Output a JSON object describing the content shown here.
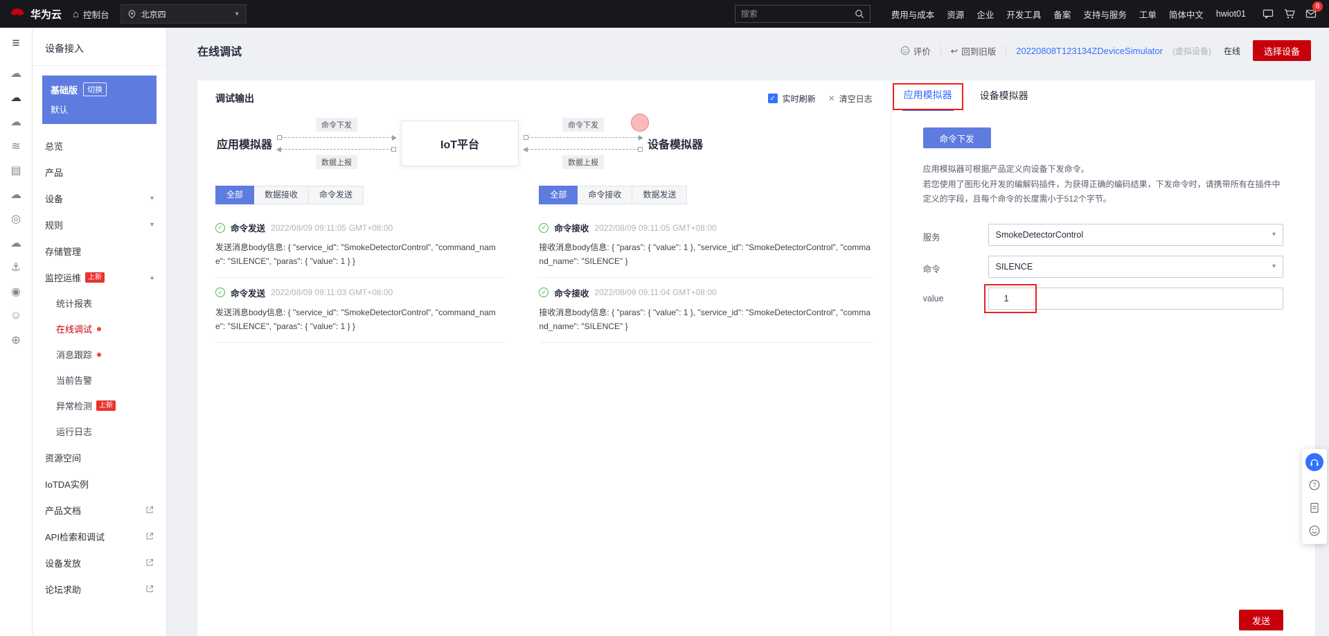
{
  "colors": {
    "accent_blue": "#5e7ce0",
    "link_blue": "#3370ff",
    "brand_red": "#c7000b",
    "badge_red": "#e8322e",
    "success_green": "#49b84c",
    "annotation_red": "#f21d1d"
  },
  "icons": {
    "menu": "≡",
    "home": "⌂",
    "caret_down": "▾",
    "caret_up": "▴",
    "check": "✓",
    "clear": "✕",
    "return": "↩"
  },
  "topbar": {
    "brand": "华为云",
    "console_label": "控制台",
    "region": "北京四",
    "search_placeholder": "搜索",
    "links": [
      "费用与成本",
      "资源",
      "企业",
      "开发工具",
      "备案",
      "支持与服务",
      "工单",
      "简体中文"
    ],
    "username": "hwiot01",
    "notification_count": "8"
  },
  "rail": {
    "glyphs": [
      "☁",
      "☁",
      "☁",
      "≋",
      "▤",
      "☁",
      "◎",
      "☁",
      "⚓",
      "◉",
      "☺",
      "⊕"
    ]
  },
  "sidebar": {
    "title": "设备接入",
    "edition": {
      "name": "基础版",
      "switch_label": "切换",
      "instance": "默认"
    },
    "items": [
      {
        "label": "总览"
      },
      {
        "label": "产品"
      },
      {
        "label": "设备"
      },
      {
        "label": "规则"
      },
      {
        "label": "存储管理"
      },
      {
        "label": "监控运维",
        "badge": "上新"
      }
    ],
    "subitems": [
      {
        "label": "统计报表"
      },
      {
        "label": "在线调试"
      },
      {
        "label": "消息跟踪"
      },
      {
        "label": "当前告警"
      },
      {
        "label": "异常检测",
        "badge": "上新"
      },
      {
        "label": "运行日志"
      }
    ],
    "items_bottom": [
      {
        "label": "资源空间"
      },
      {
        "label": "IoTDA实例"
      }
    ],
    "external_links": [
      {
        "label": "产品文档"
      },
      {
        "label": "API检索和调试"
      },
      {
        "label": "设备发放"
      },
      {
        "label": "论坛求助"
      }
    ]
  },
  "page_header": {
    "title": "在线调试",
    "feedback_label": "评价",
    "back_to_old_label": "回到旧版",
    "device_name": "20220808T123134ZDeviceSimulator",
    "device_type": "(虚拟设备)",
    "device_status": "在线",
    "select_device_label": "选择设备"
  },
  "debug": {
    "title": "调试输出",
    "realtime_refresh_label": "实时刷新",
    "clear_logs_label": "清空日志",
    "flow": {
      "app_node": "应用模拟器",
      "platform_node": "IoT平台",
      "device_node": "设备模拟器",
      "command_down_label": "命令下发",
      "data_up_label": "数据上报"
    },
    "left_tabs": [
      "全部",
      "数据接收",
      "命令发送"
    ],
    "right_tabs": [
      "全部",
      "命令接收",
      "数据发送"
    ],
    "left_logs": [
      {
        "type": "命令发送",
        "time": "2022/08/09 09:11:05 GMT+08:00",
        "body": "发送消息body信息: { \"service_id\": \"SmokeDetectorControl\", \"command_name\": \"SILENCE\", \"paras\": { \"value\": 1 } }"
      },
      {
        "type": "命令发送",
        "time": "2022/08/09 09:11:03 GMT+08:00",
        "body": "发送消息body信息: { \"service_id\": \"SmokeDetectorControl\", \"command_name\": \"SILENCE\", \"paras\": { \"value\": 1 } }"
      }
    ],
    "right_logs": [
      {
        "type": "命令接收",
        "time": "2022/08/09 09:11:05 GMT+08:00",
        "body": "接收消息body信息: { \"paras\": { \"value\": 1 }, \"service_id\": \"SmokeDetectorControl\", \"command_name\": \"SILENCE\" }"
      },
      {
        "type": "命令接收",
        "time": "2022/08/09 09:11:04 GMT+08:00",
        "body": "接收消息body信息: { \"paras\": { \"value\": 1 }, \"service_id\": \"SmokeDetectorControl\", \"command_name\": \"SILENCE\" }"
      }
    ]
  },
  "simulator": {
    "tab_app": "应用模拟器",
    "tab_device": "设备模拟器",
    "command_button_label": "命令下发",
    "desc_line1": "应用模拟器可根据产品定义向设备下发命令。",
    "desc_line2": "若您使用了图形化开发的编解码插件，为获得正确的编码结果，下发命令时，请携带所有在插件中定义的字段，且每个命令的长度需小于512个字节。",
    "form": {
      "service_label": "服务",
      "service_value": "SmokeDetectorControl",
      "command_label": "命令",
      "command_value": "SILENCE",
      "value_label": "value",
      "value_value": "1"
    },
    "send_button_label": "发送"
  }
}
